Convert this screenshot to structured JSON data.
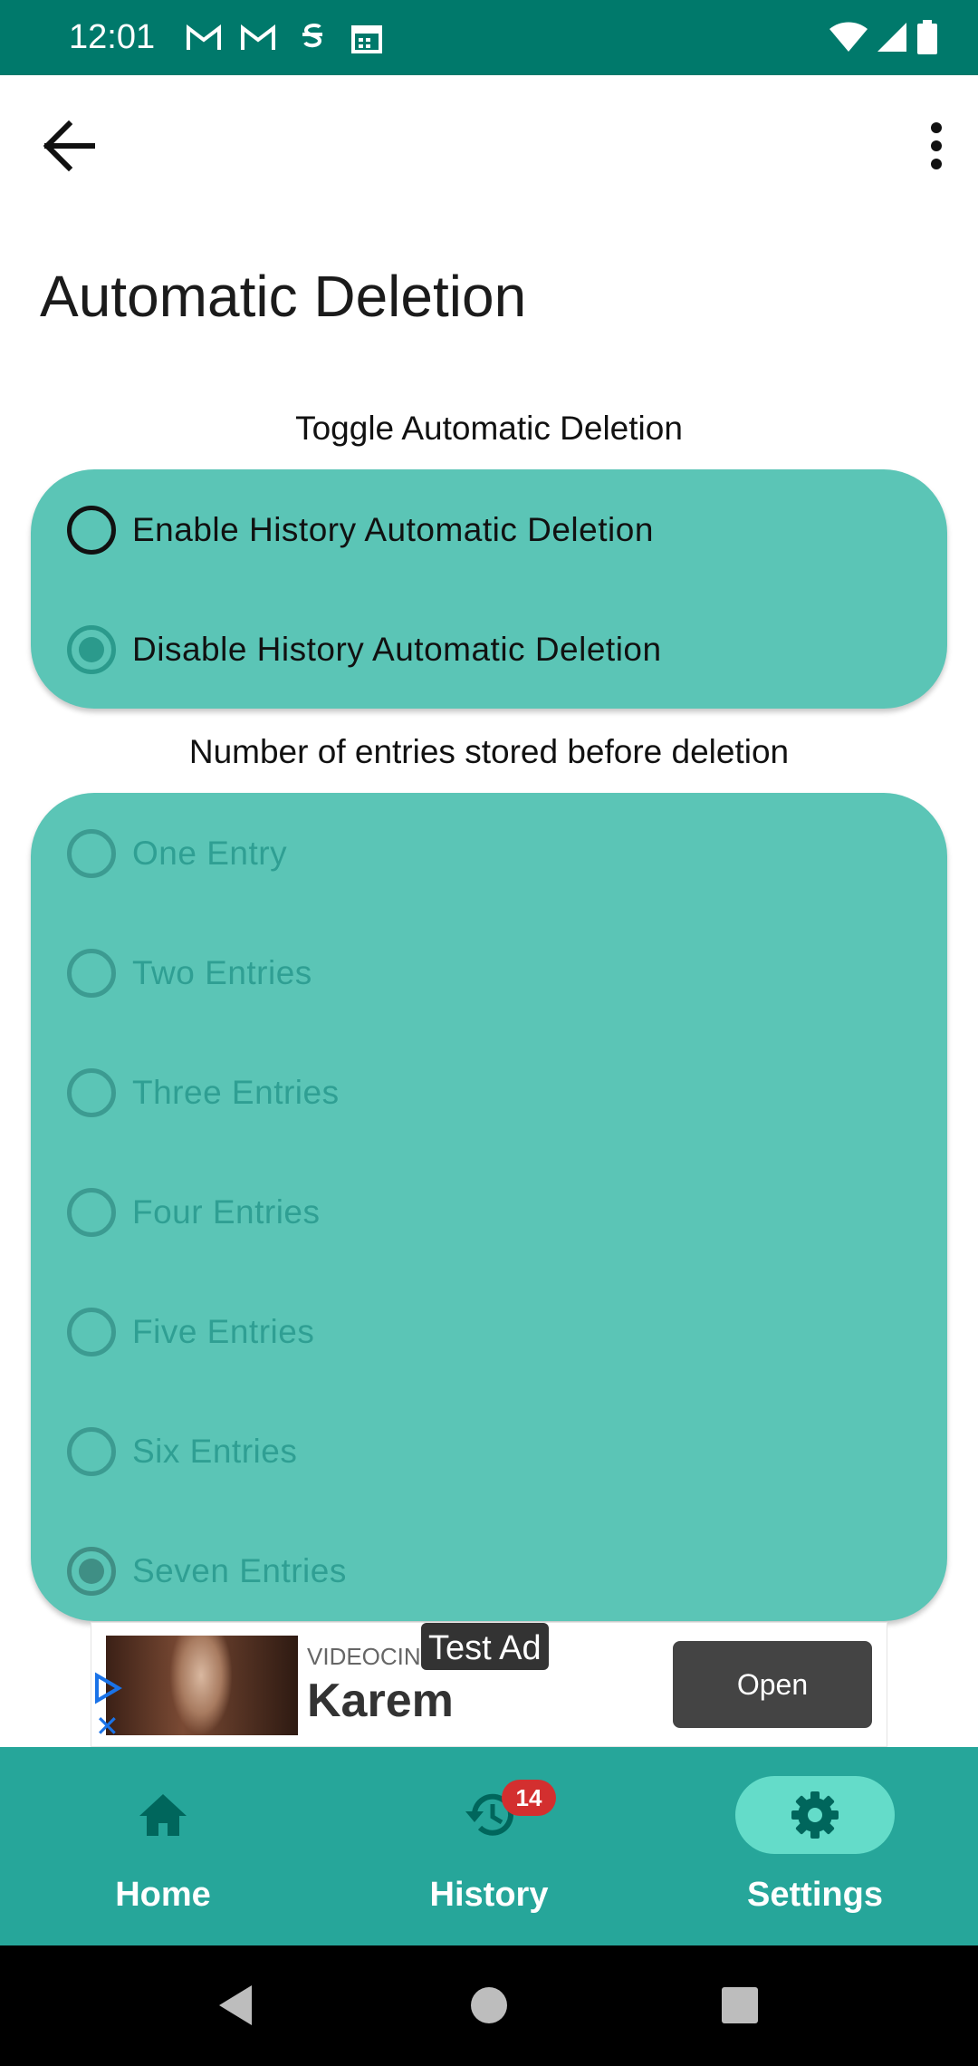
{
  "status_bar": {
    "time": "12:01",
    "left_icons": [
      "gmail-icon",
      "gmail-icon",
      "sim-icon",
      "calendar-icon"
    ],
    "right_icons": [
      "wifi-icon",
      "signal-icon",
      "battery-icon"
    ]
  },
  "app_bar": {
    "back_icon": "arrow-back-icon",
    "menu_icon": "more-vert-icon"
  },
  "page": {
    "title": "Automatic Deletion"
  },
  "toggle_section": {
    "label": "Toggle Automatic Deletion",
    "options": [
      {
        "label": "Enable History Automatic Deletion",
        "selected": false
      },
      {
        "label": "Disable History Automatic Deletion",
        "selected": true
      }
    ]
  },
  "entries_section": {
    "label": "Number of entries stored before deletion",
    "enabled": false,
    "options": [
      {
        "label": "One Entry",
        "selected": false
      },
      {
        "label": "Two Entries",
        "selected": false
      },
      {
        "label": "Three Entries",
        "selected": false
      },
      {
        "label": "Four Entries",
        "selected": false
      },
      {
        "label": "Five Entries",
        "selected": false
      },
      {
        "label": "Six Entries",
        "selected": false
      },
      {
        "label": "Seven Entries",
        "selected": true
      }
    ]
  },
  "ad": {
    "tag": "Test Ad",
    "advertiser": "VIDEOCINE",
    "title": "Karem",
    "cta": "Open"
  },
  "bottom_nav": {
    "items": [
      {
        "label": "Home",
        "icon": "home-icon",
        "active": false
      },
      {
        "label": "History",
        "icon": "history-icon",
        "active": false,
        "badge": "14"
      },
      {
        "label": "Settings",
        "icon": "settings-gear-icon",
        "active": true
      }
    ]
  },
  "colors": {
    "status_bar": "#00796b",
    "card": "#5bc5b6",
    "nav": "#26a69a",
    "nav_active_pill": "#64dcc9",
    "badge": "#d32f2f"
  }
}
